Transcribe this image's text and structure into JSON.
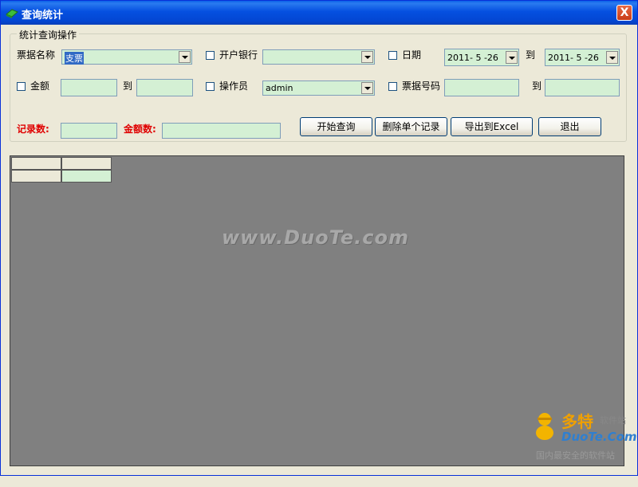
{
  "window": {
    "title": "查询统计",
    "close": "X"
  },
  "group": {
    "title": "统计查询操作"
  },
  "row1": {
    "ticket_label": "票据名称",
    "ticket_value": "支票",
    "bank_label": "开户银行",
    "bank_value": "",
    "date_label": "日期",
    "date_from": "2011- 5 -26",
    "to": "到",
    "date_to": "2011- 5 -26"
  },
  "row2": {
    "amount_label": "金额",
    "to": "到",
    "operator_label": "操作员",
    "operator_value": "admin",
    "ticket_no_label": "票据号码",
    "to2": "到"
  },
  "row3": {
    "record_count_label": "记录数:",
    "amount_count_label": "金额数:",
    "buttons": {
      "start_query": "开始查询",
      "delete_record": "删除单个记录",
      "export_excel": "导出到Excel",
      "exit": "退出"
    }
  },
  "watermark": "www.DuoTe.com",
  "brand": {
    "cn": "多特",
    "sub": "软件站",
    "en": "DuoTe.Com",
    "tag": "国内最安全的软件站"
  },
  "colors": {
    "field_bg": "#D4F0D4",
    "grid_bg": "#808080",
    "label_red": "#E00000",
    "title_bar": "#0550E0"
  }
}
